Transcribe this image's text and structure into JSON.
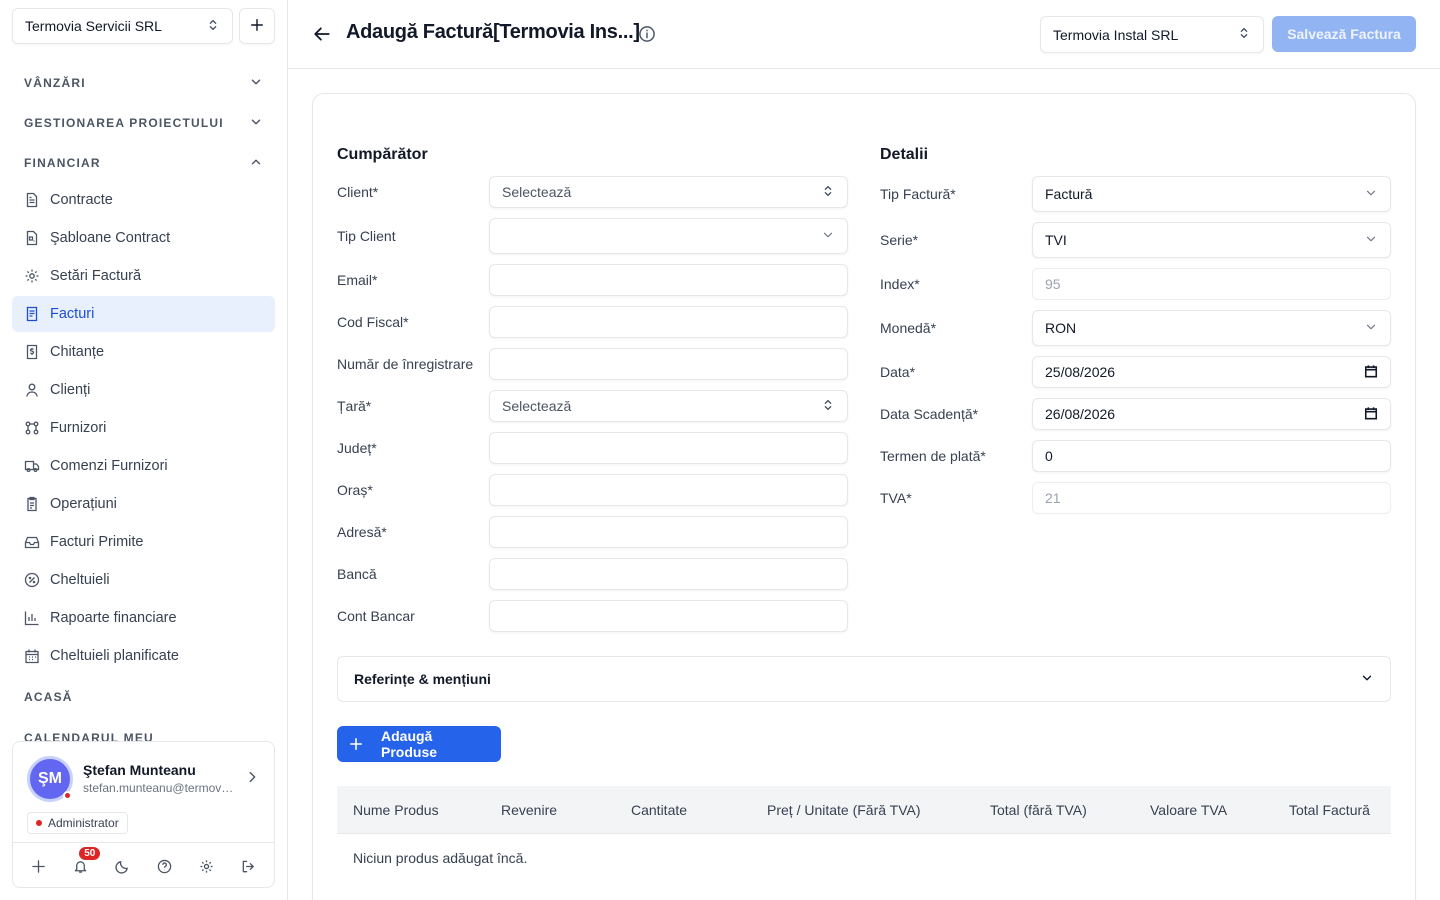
{
  "sidebar": {
    "company": "Termovia Servicii SRL",
    "sections": {
      "vanzari": "VÂNZĂRI",
      "proiect": "GESTIONAREA PROIECTULUI",
      "financiar": "FINANCIAR",
      "acasa": "ACASĂ",
      "calendar": "CALENDARUL MEU"
    },
    "items": [
      {
        "label": "Contracte",
        "icon": "file-text-icon"
      },
      {
        "label": "Şabloane Contract",
        "icon": "file-template-icon"
      },
      {
        "label": "Setări Factură",
        "icon": "gear-icon"
      },
      {
        "label": "Facturi",
        "icon": "invoice-icon",
        "active": true
      },
      {
        "label": "Chitanțe",
        "icon": "receipt-icon"
      },
      {
        "label": "Clienți",
        "icon": "user-icon"
      },
      {
        "label": "Furnizori",
        "icon": "network-icon"
      },
      {
        "label": "Comenzi Furnizori",
        "icon": "truck-icon"
      },
      {
        "label": "Operațiuni",
        "icon": "clipboard-icon"
      },
      {
        "label": "Facturi Primite",
        "icon": "inbox-icon"
      },
      {
        "label": "Cheltuieli",
        "icon": "circle-percent-icon"
      },
      {
        "label": "Rapoarte financiare",
        "icon": "bar-chart-icon"
      },
      {
        "label": "Cheltuieli planificate",
        "icon": "calendar-icon"
      }
    ],
    "user": {
      "initials": "ŞM",
      "name": "Ştefan Munteanu",
      "email": "stefan.munteanu@termovia.ro",
      "role": "Administrator",
      "notifications": "50"
    }
  },
  "header": {
    "title": "Adaugă Factură[Termovia Ins...]",
    "issuer": "Termovia Instal SRL",
    "save": "Salvează Factura"
  },
  "buyer": {
    "title": "Cumpărător",
    "client_label": "Client*",
    "client_value": "Selectează",
    "tip_client_label": "Tip Client",
    "email_label": "Email*",
    "cod_fiscal_label": "Cod Fiscal*",
    "nr_inreg_label": "Număr de înregistrare",
    "tara_label": "Țară*",
    "tara_value": "Selectează",
    "judet_label": "Județ*",
    "oras_label": "Oraș*",
    "adresa_label": "Adresă*",
    "banca_label": "Bancă",
    "cont_label": "Cont Bancar"
  },
  "details": {
    "title": "Detalii",
    "tip_factura_label": "Tip Factură*",
    "tip_factura_value": "Factură",
    "serie_label": "Serie*",
    "serie_value": "TVI",
    "index_label": "Index*",
    "index_value": "95",
    "moneda_label": "Monedă*",
    "moneda_value": "RON",
    "data_label": "Data*",
    "data_value": "25/08/2026",
    "scadenta_label": "Data Scadență*",
    "scadenta_value": "26/08/2026",
    "termen_label": "Termen de plată*",
    "termen_value": "0",
    "tva_label": "TVA*",
    "tva_value": "21"
  },
  "references": "Referințe & mențiuni",
  "add_products": "Adaugă Produse",
  "table": {
    "columns": [
      "Nume Produs",
      "Revenire",
      "Cantitate",
      "Preț / Unitate (Fără TVA)",
      "Total (fără TVA)",
      "Valoare TVA",
      "Total Factură"
    ],
    "empty": "Niciun produs adăugat încă."
  },
  "colors": {
    "accent": "#2563eb",
    "active_bg": "#e8effd",
    "save_disabled": "#93b4f3",
    "badge": "#dc2626"
  }
}
